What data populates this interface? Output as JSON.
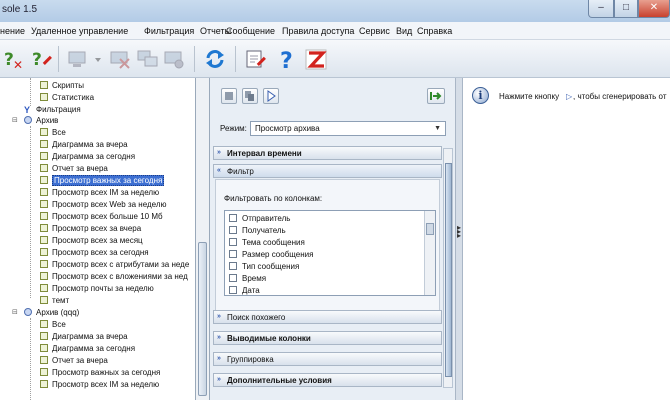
{
  "window": {
    "title": "sole 1.5",
    "min_glyph": "–",
    "max_glyph": "□",
    "close_glyph": "✕"
  },
  "menu": [
    "нение",
    "Удаленное управление",
    "Фильтрация",
    "Отчеты",
    "Сообщение",
    "Правила доступа",
    "Сервис",
    "Вид",
    "Справка"
  ],
  "toolbar": {
    "help_glyph": "?"
  },
  "tree": {
    "section_nodes": [
      "Скрипты",
      "Статистика"
    ],
    "filter_label": "Фильтрация",
    "archive_label": "Архив",
    "archive_items": [
      "Все",
      "Диаграмма за вчера",
      "Диаграмма за сегодня",
      "Отчет за вчера",
      "Просмотр важных за сегодня",
      "Просмотр всех IM за неделю",
      "Просмотр всех Web за неделю",
      "Просмотр всех больше 10 Мб",
      "Просмотр всех за вчера",
      "Просмотр всех за месяц",
      "Просмотр всех за сегодня",
      "Просмотр всех с атрибутами за неде",
      "Просмотр всех с вложениями за нед",
      "Просмотр почты за неделю",
      "темт"
    ],
    "archive2_label": "Архив (qqq)",
    "archive2_items": [
      "Все",
      "Диаграмма за вчера",
      "Диаграмма за сегодня",
      "Отчет за вчера",
      "Просмотр важных за сегодня",
      "Просмотр всех IM за неделю"
    ]
  },
  "mode": {
    "label": "Режим:",
    "value": "Просмотр архива"
  },
  "sections": {
    "interval": "Интервал времени",
    "filter": "Фильтр",
    "similar": "Поиск похожего",
    "output_columns": "Выводимые колонки",
    "grouping": "Группировка",
    "extra_conditions": "Дополнительные условия"
  },
  "filter_panel": {
    "label": "Фильтровать по колонкам:",
    "columns": [
      "Отправитель",
      "Получатель",
      "Тема сообщения",
      "Размер сообщения",
      "Тип сообщения",
      "Время",
      "Дата"
    ]
  },
  "info": {
    "text_before": "Нажмите кнопку",
    "text_after": ", чтобы сгенерировать от"
  }
}
